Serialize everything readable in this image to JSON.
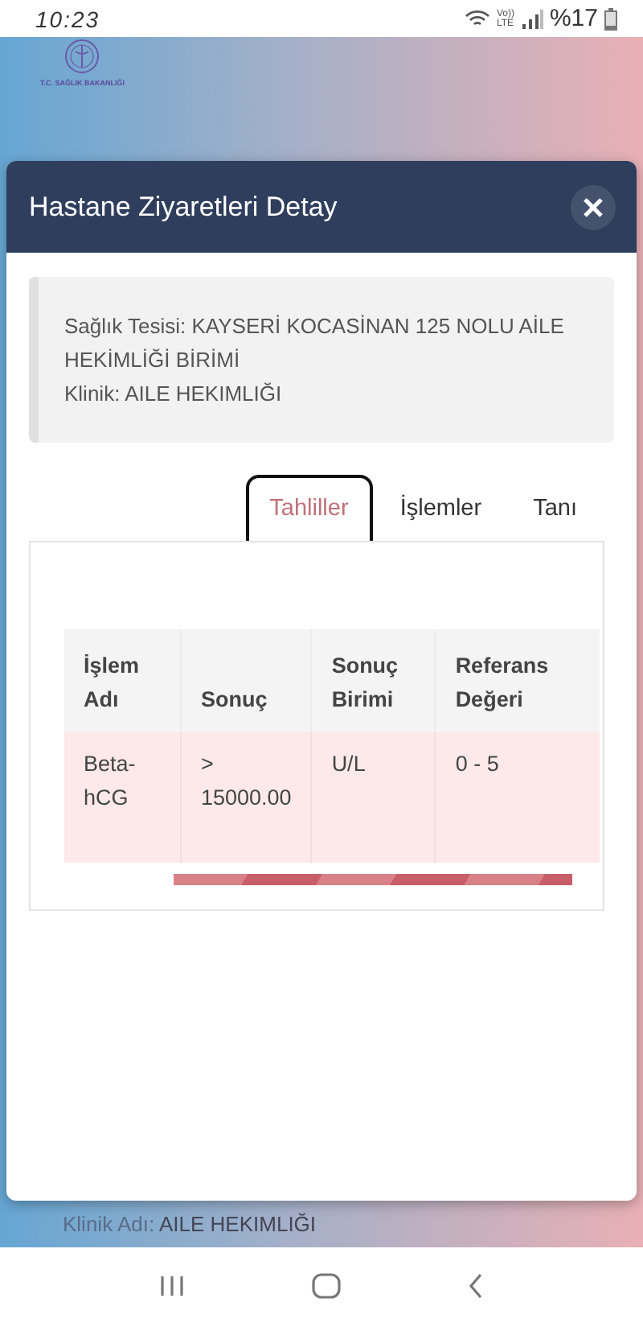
{
  "status_bar": {
    "time": "10:23",
    "network_top": "Vo))",
    "network_bottom": "LTE",
    "battery": "%17"
  },
  "logo": {
    "caption": "T.C. SAĞLIK BAKANLIĞI"
  },
  "modal": {
    "title": "Hastane Ziyaretleri Detay",
    "info": [
      "Sağlık Tesisi: KAYSERİ KOCASİNAN 125 NOLU AİLE HEKİMLİĞİ BİRİMİ",
      "Klinik: AILE HEKIMLIĞI"
    ],
    "tabs": [
      {
        "label": "Tahliller",
        "selected": true
      },
      {
        "label": "İşlemler",
        "selected": false
      },
      {
        "label": "Tanı",
        "selected": false
      }
    ],
    "table": {
      "columns": [
        "İşlem Adı",
        "Sonuç",
        "Sonuç Birimi",
        "Referans Değeri"
      ],
      "rows": [
        [
          "Beta-hCG",
          "> 15000.00",
          "U/L",
          "0 - 5"
        ]
      ]
    }
  },
  "background_text": {
    "label": "Klinik Adı:",
    "value": "AILE HEKIMLIĞI"
  }
}
